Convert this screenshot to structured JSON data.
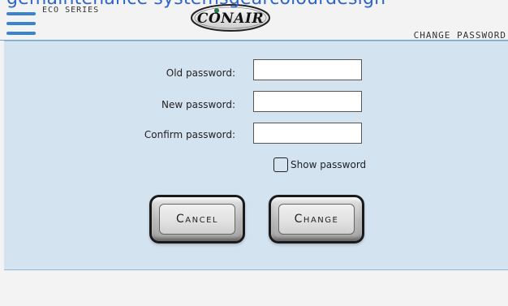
{
  "top_clip": {
    "text": "gemaintenance systemsgearcolourdesign"
  },
  "header": {
    "series": "ECO SERIES",
    "logo_text": "CONAIR",
    "page_title": "CHANGE PASSWORD"
  },
  "form": {
    "old_label": "Old password:",
    "new_label": "New password:",
    "confirm_label": "Confirm password:",
    "old_value": "",
    "new_value": "",
    "confirm_value": "",
    "show_password_label": "Show password"
  },
  "buttons": {
    "cancel": "Cancel",
    "change": "Change"
  },
  "colors": {
    "accent": "#3a84cf",
    "panel": "#d4e3f0"
  },
  "icons": {
    "menu": "menu-icon",
    "logo": "conair-logo"
  }
}
